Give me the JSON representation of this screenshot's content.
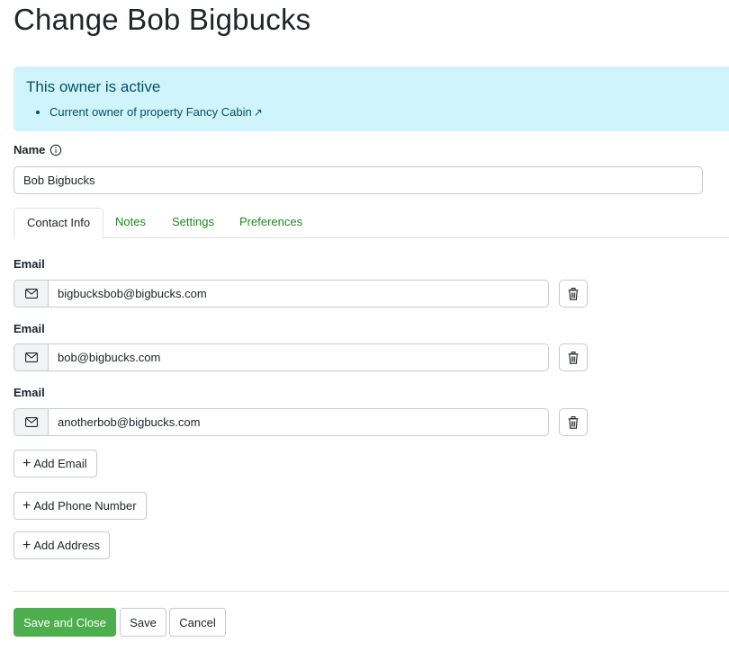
{
  "page": {
    "title": "Change Bob Bigbucks"
  },
  "alert": {
    "heading": "This owner is active",
    "items": [
      {
        "text": "Current owner of property Fancy Cabin",
        "link_icon": "↗"
      }
    ]
  },
  "name_field": {
    "label": "Name",
    "value": "Bob Bigbucks"
  },
  "tabs": [
    {
      "label": "Contact Info",
      "active": true
    },
    {
      "label": "Notes",
      "active": false
    },
    {
      "label": "Settings",
      "active": false
    },
    {
      "label": "Preferences",
      "active": false
    }
  ],
  "emails": [
    {
      "label": "Email",
      "value": "bigbucksbob@bigbucks.com"
    },
    {
      "label": "Email",
      "value": "bob@bigbucks.com"
    },
    {
      "label": "Email",
      "value": "anotherbob@bigbucks.com"
    }
  ],
  "add_buttons": {
    "email": "Add Email",
    "phone": "Add Phone Number",
    "address": "Add Address"
  },
  "footer": {
    "save_and_close": "Save and Close",
    "save": "Save",
    "cancel": "Cancel"
  },
  "icons": {
    "plus": "+",
    "info": "info-circle-icon",
    "envelope": "envelope-icon",
    "trash": "trash-icon"
  },
  "colors": {
    "alert_bg": "#cff4fc",
    "alert_text": "#055160",
    "tab_link": "#1e8a1e",
    "primary_button": "#4cae4c"
  }
}
